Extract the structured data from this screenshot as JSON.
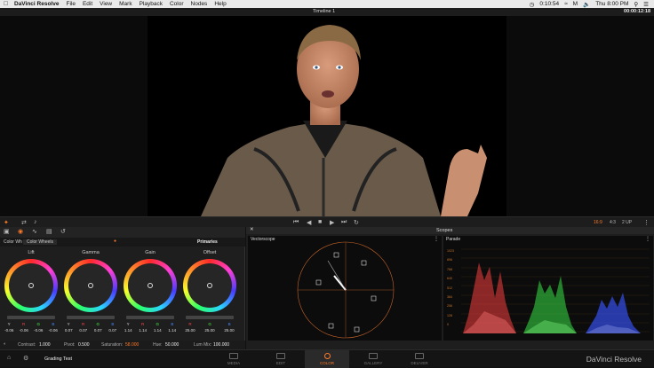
{
  "menubar": {
    "app": "DaVinci Resolve",
    "items": [
      "File",
      "Edit",
      "View",
      "Mark",
      "Playback",
      "Color",
      "Nodes",
      "Help"
    ],
    "time_left": "0:10:54",
    "clock": "Thu 8:00 PM",
    "m_badge": "M"
  },
  "window": {
    "timeline": "Timeline 1",
    "timecode": "00:00:12:18"
  },
  "viewer_toolbar": {
    "zoom_a": "16:9",
    "zoom_b": "4:3",
    "layout": "2 UP"
  },
  "color_panel": {
    "tab_label": "Color Wheels",
    "tab_short": "Color Wh",
    "mode": "Primaries",
    "channels": [
      "Y",
      "R",
      "G",
      "B"
    ],
    "wheels": [
      {
        "name": "Lift",
        "values": [
          "-0.06",
          "-0.06",
          "-0.06",
          "-0.06"
        ]
      },
      {
        "name": "Gamma",
        "values": [
          "0.07",
          "0.07",
          "0.07",
          "0.07"
        ]
      },
      {
        "name": "Gain",
        "values": [
          "1.14",
          "1.14",
          "1.14",
          "1.14"
        ]
      },
      {
        "name": "Offset",
        "values": [
          "25.00",
          "25.00",
          "25.00",
          "25.00"
        ]
      }
    ],
    "bottom": {
      "contrast_label": "Contrast:",
      "contrast": "1.000",
      "pivot_label": "Pivot:",
      "pivot": "0.500",
      "saturation_label": "Saturation:",
      "saturation": "58.000",
      "hue_label": "Hue:",
      "hue": "50.000",
      "lum_label": "Lum Mix:",
      "lum": "100.000"
    }
  },
  "scopes": {
    "title": "Scopes",
    "vectorscope": "Vectorscope",
    "parade": "Parade",
    "scale": [
      "1023",
      "896",
      "768",
      "640",
      "512",
      "384",
      "256",
      "128",
      "0"
    ]
  },
  "navbar": {
    "project": "Grading Test",
    "pages": [
      "MEDIA",
      "EDIT",
      "COLOR",
      "GALLERY",
      "DELIVER"
    ],
    "active": "COLOR",
    "brand": "DaVinci Resolve"
  },
  "colors": {
    "accent": "#ff7a2a",
    "menubar": "#e9e9e9"
  }
}
